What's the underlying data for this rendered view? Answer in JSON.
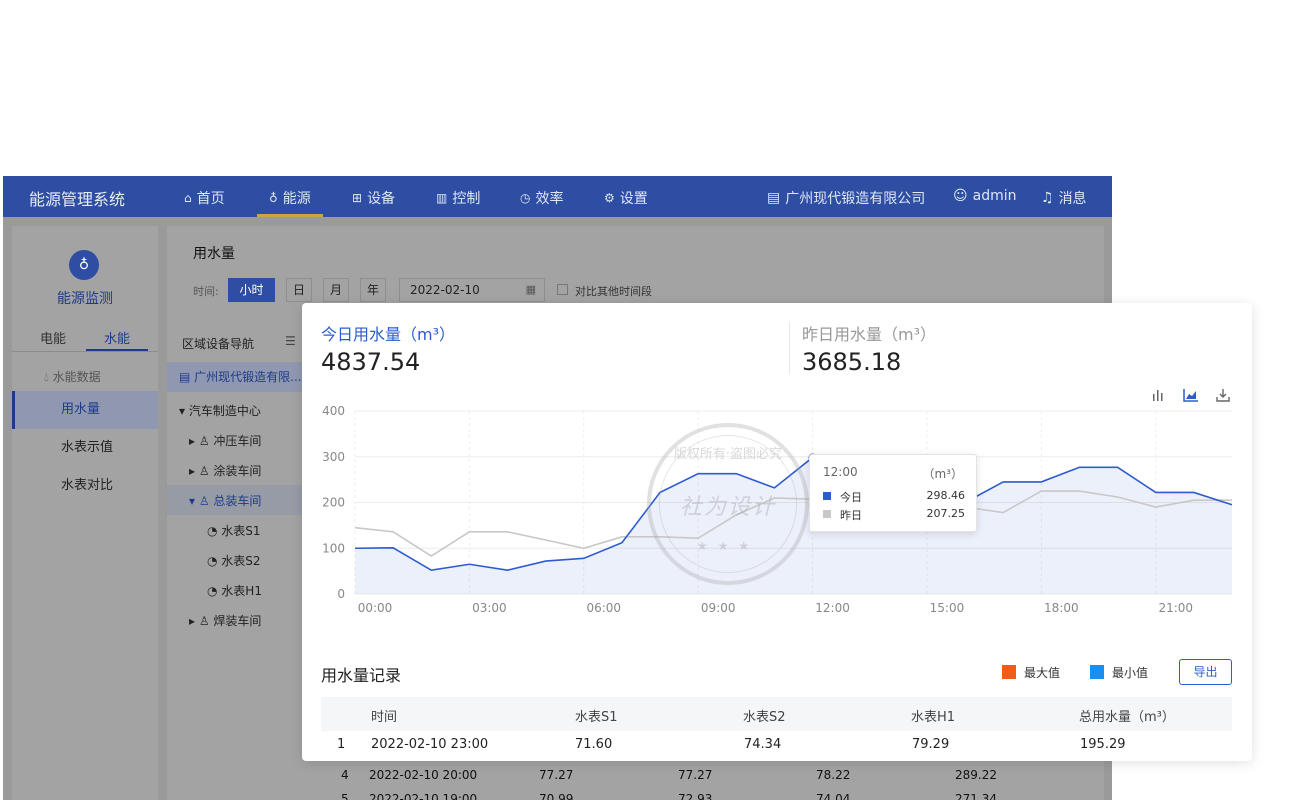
{
  "app": {
    "brand": "能源管理系统",
    "nav": [
      {
        "label": "首页",
        "icon": "home-icon",
        "glyph": "⌂"
      },
      {
        "label": "能源",
        "icon": "bulb-icon",
        "glyph": "♁"
      },
      {
        "label": "设备",
        "icon": "grid-icon",
        "glyph": "⊞"
      },
      {
        "label": "控制",
        "icon": "panel-icon",
        "glyph": "▥"
      },
      {
        "label": "效率",
        "icon": "clock-icon",
        "glyph": "◷"
      },
      {
        "label": "设置",
        "icon": "gear-icon",
        "glyph": "⚙"
      }
    ],
    "company": "广州现代锻造有限公司",
    "user": "admin",
    "messages": "消息"
  },
  "leftpanel": {
    "title": "能源监测",
    "tabs": [
      "电能",
      "水能"
    ],
    "section": "水能数据",
    "items": [
      "用水量",
      "水表示值",
      "水表对比"
    ]
  },
  "filter": {
    "page_title": "用水量",
    "time_label": "时间:",
    "granularity": [
      "小时",
      "日",
      "月",
      "年"
    ],
    "date": "2022-02-10",
    "compare_label": "对比其他时间段"
  },
  "tree": {
    "header": "区域设备导航",
    "root": "广州现代锻造有限...",
    "nodes": [
      "汽车制造中心",
      "冲压车间",
      "涂装车间",
      "总装车间",
      "水表S1",
      "水表S2",
      "水表H1",
      "焊装车间"
    ]
  },
  "background_rows": [
    [
      "4",
      "2022-02-10 20:00",
      "77.27",
      "77.27",
      "78.22",
      "289.22"
    ],
    [
      "5",
      "2022-02-10 19:00",
      "70.99",
      "72.93",
      "74.04",
      "271.34"
    ]
  ],
  "stats": {
    "today_label": "今日用水量（m³）",
    "today_value": "4837.54",
    "yesterday_label": "昨日用水量（m³）",
    "yesterday_value": "3685.18",
    "today_color": "#2d5bd0",
    "yesterday_color": "#999999"
  },
  "watermark": {
    "top": "版权所有·盗图必究",
    "main": "社为设计",
    "stars": "★★★"
  },
  "chart_data": {
    "type": "area",
    "x": [
      "00:00",
      "01:00",
      "02:00",
      "03:00",
      "04:00",
      "05:00",
      "06:00",
      "07:00",
      "08:00",
      "09:00",
      "10:00",
      "11:00",
      "12:00",
      "13:00",
      "14:00",
      "15:00",
      "16:00",
      "17:00",
      "18:00",
      "19:00",
      "20:00",
      "21:00",
      "22:00",
      "23:00"
    ],
    "xticks": [
      "00:00",
      "03:00",
      "06:00",
      "09:00",
      "12:00",
      "15:00",
      "18:00",
      "21:00"
    ],
    "ylim": [
      0,
      400
    ],
    "yticks": [
      0,
      100,
      200,
      300,
      400
    ],
    "series": [
      {
        "name": "今日",
        "color": "#2d5bd0",
        "values": [
          100,
          101,
          52,
          65,
          52,
          72,
          78,
          112,
          222,
          263,
          263,
          232,
          298.46,
          265,
          220,
          195,
          200,
          245,
          245,
          277,
          277,
          222,
          222,
          195
        ]
      },
      {
        "name": "昨日",
        "color": "#c8c8c8",
        "values": [
          145,
          136,
          83,
          136,
          136,
          118,
          100,
          125,
          125,
          122,
          173,
          210,
          207.25,
          210,
          205,
          195,
          190,
          178,
          225,
          225,
          212,
          190,
          205,
          205
        ]
      }
    ],
    "tooltip": {
      "time": "12:00",
      "unit": "（m³）",
      "today_name": "今日",
      "today_value": "298.46",
      "yesterday_name": "昨日",
      "yesterday_value": "207.25"
    }
  },
  "records": {
    "title": "用水量记录",
    "legend": [
      {
        "label": "最大值",
        "color": "#f05a1a"
      },
      {
        "label": "最小值",
        "color": "#1a8ff0"
      }
    ],
    "export_label": "导出",
    "columns": [
      "时间",
      "水表S1",
      "水表S2",
      "水表H1",
      "总用水量（m³）"
    ],
    "rows": [
      [
        "1",
        "2022-02-10 23:00",
        "71.60",
        "74.34",
        "79.29",
        "195.29"
      ]
    ]
  }
}
